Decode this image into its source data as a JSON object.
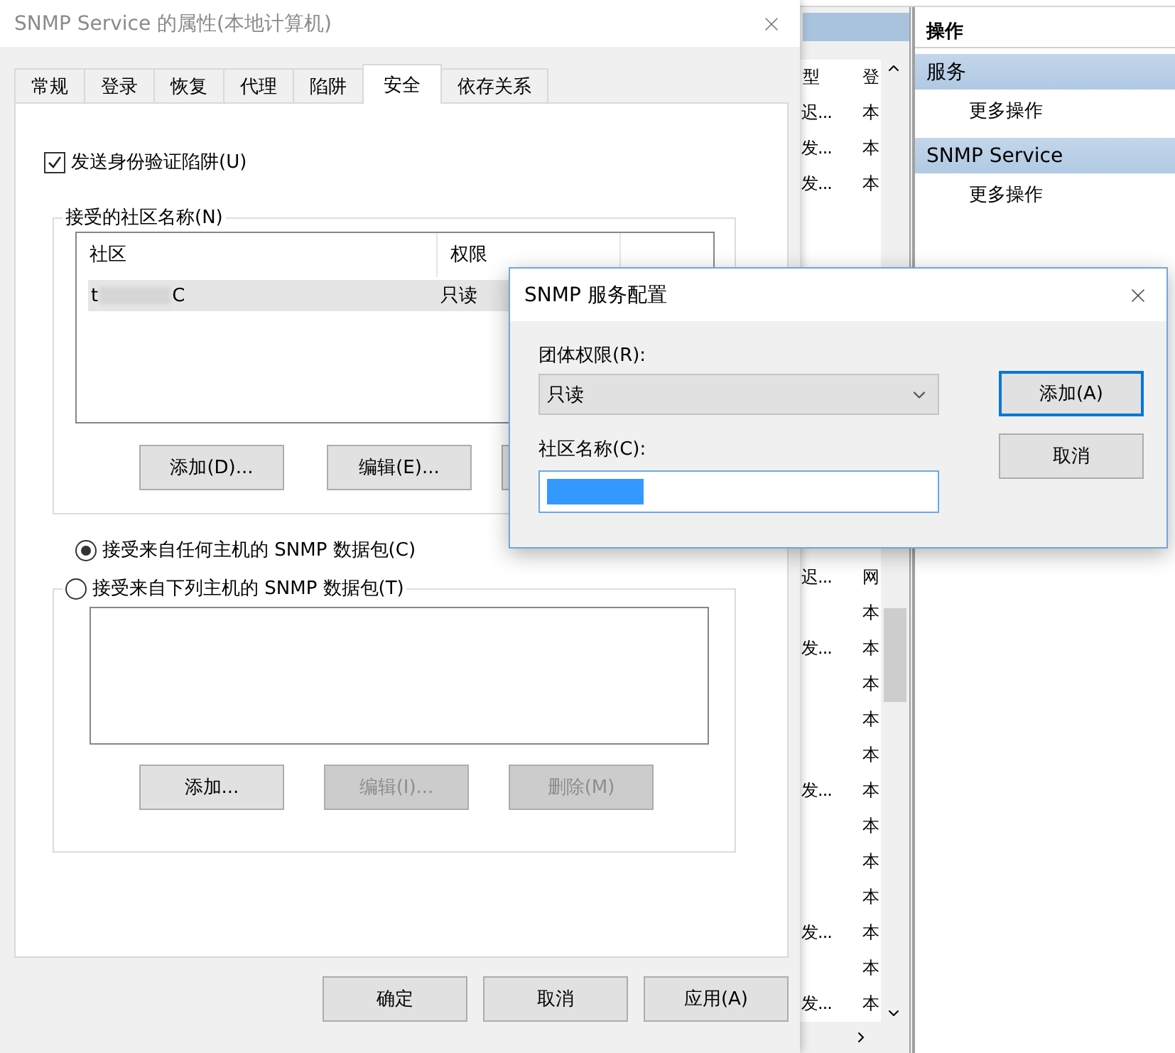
{
  "background_window": {
    "list_columns": [
      "型",
      "登"
    ],
    "rows_top": [
      {
        "cell_1": "迟...",
        "cell_2": "本"
      },
      {
        "cell_1": "发...",
        "cell_2": "本"
      },
      {
        "cell_1": "发...",
        "cell_2": "本"
      }
    ],
    "rows_bottom": [
      {
        "cell_1": "迟...",
        "cell_2": "网"
      },
      {
        "cell_2": "本"
      },
      {
        "cell_1": "发...",
        "cell_2": "本"
      },
      {
        "cell_2": "本"
      },
      {
        "cell_2": "本"
      },
      {
        "cell_2": "本"
      },
      {
        "cell_1": "发...",
        "cell_2": "本"
      },
      {
        "cell_2": "本"
      },
      {
        "cell_2": "本"
      },
      {
        "cell_2": "本"
      },
      {
        "cell_1": "发...",
        "cell_2": "本"
      },
      {
        "cell_2": "本"
      },
      {
        "cell_1": "发...",
        "cell_2": "本"
      }
    ],
    "actions_pane": {
      "header": "操作",
      "sections": [
        {
          "title": "服务",
          "items": [
            "更多操作"
          ]
        },
        {
          "title": "SNMP Service",
          "items": [
            "更多操作"
          ]
        }
      ]
    }
  },
  "properties_dialog": {
    "title": "SNMP Service 的属性(本地计算机)",
    "tabs": [
      {
        "label": "常规",
        "selected": false
      },
      {
        "label": "登录",
        "selected": false
      },
      {
        "label": "恢复",
        "selected": false
      },
      {
        "label": "代理",
        "selected": false
      },
      {
        "label": "陷阱",
        "selected": false
      },
      {
        "label": "安全",
        "selected": true
      },
      {
        "label": "依存关系",
        "selected": false
      }
    ],
    "auth_trap_checkbox": {
      "label": "发送身份验证陷阱(U)",
      "checked": true
    },
    "community_group": {
      "title": "接受的社区名称(N)",
      "columns": [
        "社区",
        "权限"
      ],
      "rows": [
        {
          "community_start": "t",
          "community_end": "C",
          "rights": "只读",
          "selected": true
        }
      ],
      "buttons": [
        {
          "kind": "button",
          "label": "添加(D)...",
          "disabled": false
        },
        {
          "kind": "button",
          "label": "编辑(E)...",
          "disabled": false
        },
        {
          "kind": "covered"
        }
      ]
    },
    "host_options": [
      {
        "label": "接受来自任何主机的 SNMP 数据包(C)",
        "selected": true
      },
      {
        "label": "接受来自下列主机的 SNMP 数据包(T)",
        "selected": false
      }
    ],
    "host_buttons": [
      {
        "label": "添加...",
        "disabled": false
      },
      {
        "label": "编辑(I)...",
        "disabled": true
      },
      {
        "label": "删除(M)",
        "disabled": true
      }
    ],
    "footer_buttons": [
      "确定",
      "取消",
      "应用(A)"
    ]
  },
  "config_dialog": {
    "title": "SNMP 服务配置",
    "rights_label": "团体权限(R):",
    "rights_value": "只读",
    "community_label": "社区名称(C):",
    "community_text_selected": true,
    "buttons": [
      {
        "label": "添加(A)",
        "default": true
      },
      {
        "label": "取消",
        "default": false
      }
    ]
  }
}
